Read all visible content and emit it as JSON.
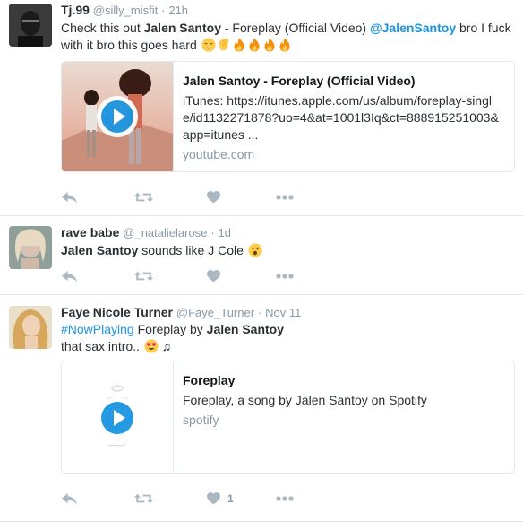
{
  "tweets": [
    {
      "fullname": "Tj.99",
      "handle": "@silly_misfit",
      "sep": "·",
      "time": "21h",
      "text_prefix": "Check this out ",
      "text_bold": "Jalen Santoy",
      "text_mid": " - Foreplay (Official Video) ",
      "mention": "@JalenSantoy",
      "text_suffix": " bro I fuck with it bro this goes hard",
      "card": {
        "title": "Jalen Santoy - Foreplay (Official Video)",
        "description": "iTunes: https://itunes.apple.com/us/album/foreplay-single/id1132271878?uo=4&at=1001l3Iq&ct=888915251003&app=itunes ...",
        "domain": "youtube.com"
      },
      "like_count": ""
    },
    {
      "fullname": "rave babe",
      "handle": "@_natalielarose",
      "sep": "·",
      "time": "1d",
      "text_bold": "Jalen Santoy",
      "text_suffix": " sounds like J Cole",
      "like_count": ""
    },
    {
      "fullname": "Faye Nicole Turner",
      "handle": "@Faye_Turner",
      "sep": "·",
      "time": "Nov 11",
      "hashtag": "#NowPlaying",
      "text_mid": " Foreplay by ",
      "text_bold": "Jalen Santoy",
      "line2": "that sax intro..",
      "music_note": "♫",
      "card": {
        "title": "Foreplay",
        "description": "Foreplay, a song by Jalen Santoy on Spotify",
        "domain": "spotify"
      },
      "like_count": "1"
    }
  ],
  "icons": [
    "reply-icon",
    "retweet-icon",
    "like-icon",
    "more-icon"
  ],
  "colors": {
    "link": "#1b95e0",
    "icon": "#aab8c2",
    "meta": "#8899a6",
    "border": "#e1e8ed"
  }
}
